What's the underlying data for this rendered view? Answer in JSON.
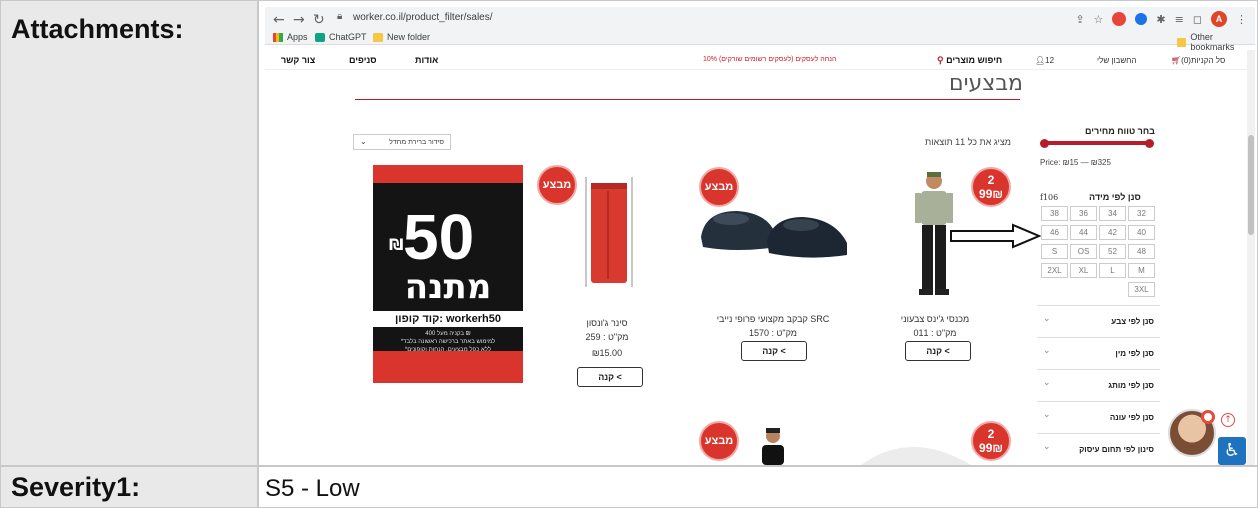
{
  "doc": {
    "attachments_label": "Attachments:",
    "severity_label": "Severity1:",
    "severity_value": "S5 - Low"
  },
  "browser": {
    "url": "worker.co.il/product_filter/sales/",
    "bookmarks": [
      "Apps",
      "ChatGPT",
      "New folder"
    ],
    "other_bookmarks": "Other bookmarks",
    "avatar_letter": "A"
  },
  "header": {
    "contact": "צור קשר",
    "branches": "סניפים",
    "about": "אודות",
    "promo": "10% הנחה לעסקים (לעסקים רשומים שורקים)",
    "search": "חיפוש מוצרים",
    "cart_count": "12",
    "account": "החשבון שלי",
    "cart": "סל הקניות(0)"
  },
  "page": {
    "title": "מבצעים",
    "results": "מציג את כל 11 תוצאות",
    "sort": "סידור ברירת מחדל"
  },
  "sidebar": {
    "price_title": "בחר טווח מחירים",
    "price_range": "Price: ₪15 — ₪325",
    "size_title": "סנן לפי מידה",
    "size_code": "f106",
    "sizes": [
      [
        "32",
        "34",
        "36",
        "38"
      ],
      [
        "40",
        "42",
        "44",
        "46"
      ],
      [
        "48",
        "52",
        "OS",
        "S"
      ],
      [
        "M",
        "L",
        "XL",
        "2XL"
      ],
      [
        "3XL"
      ]
    ],
    "sections": [
      "סנן לפי צבע",
      "סנן לפי מין",
      "סנן לפי מותג",
      "סנן לפי עונה",
      "סינון לפי תחום עיסוק"
    ]
  },
  "products": [
    {
      "name": "מכנסי ג'ינס צבעוני",
      "sku": "מק\"ט : 011",
      "buy": "קנה <",
      "badge": "2\n99₪"
    },
    {
      "name": "קבקב מקצועי פרופי נייבי SRC",
      "sku": "מק\"ט : 1570",
      "buy": "קנה <",
      "badge": "מבצע"
    },
    {
      "name": "סינר ג'ונסון",
      "sku": "מק\"ט : 259",
      "price": "₪15.00",
      "buy": "קנה <",
      "badge": "מבצע"
    }
  ],
  "promo_banner": {
    "amount": "50",
    "currency": "₪",
    "gift": "מתנה",
    "code": "קוד קופון: workerh50",
    "fine": "בקניה מעל 400 ₪\n*למימוש באתר ברכישה ראשונה בלבד\n*ללא כפל מבצעים, הנחות וקופונים"
  },
  "colors": {
    "brand_red": "#b51d2a",
    "badge_red": "#d9352c",
    "a11y_blue": "#1e73be"
  }
}
